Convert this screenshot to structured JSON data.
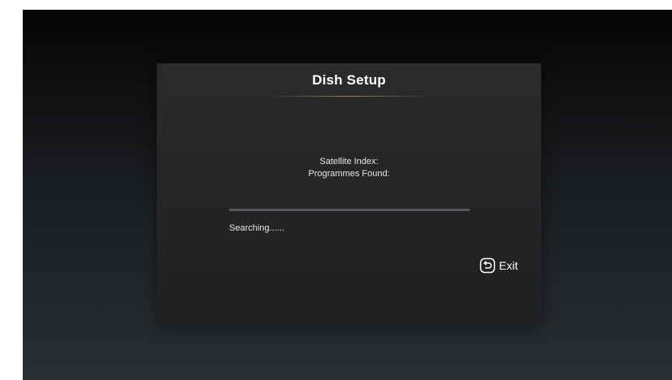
{
  "dialog": {
    "title": "Dish Setup",
    "satellite_index_label": "Satellite Index:",
    "programmes_found_label": "Programmes Found:",
    "progress": 0,
    "status_text": "Searching......",
    "exit_label": "Exit"
  },
  "icons": {
    "exit": "back-return-icon"
  },
  "colors": {
    "background_top": "#050505",
    "background_bottom": "#2a2e33",
    "dialog_bg": "#262728",
    "title_underline": "#aa8c64",
    "progress_track": "#55595d",
    "text": "#ffffff"
  }
}
